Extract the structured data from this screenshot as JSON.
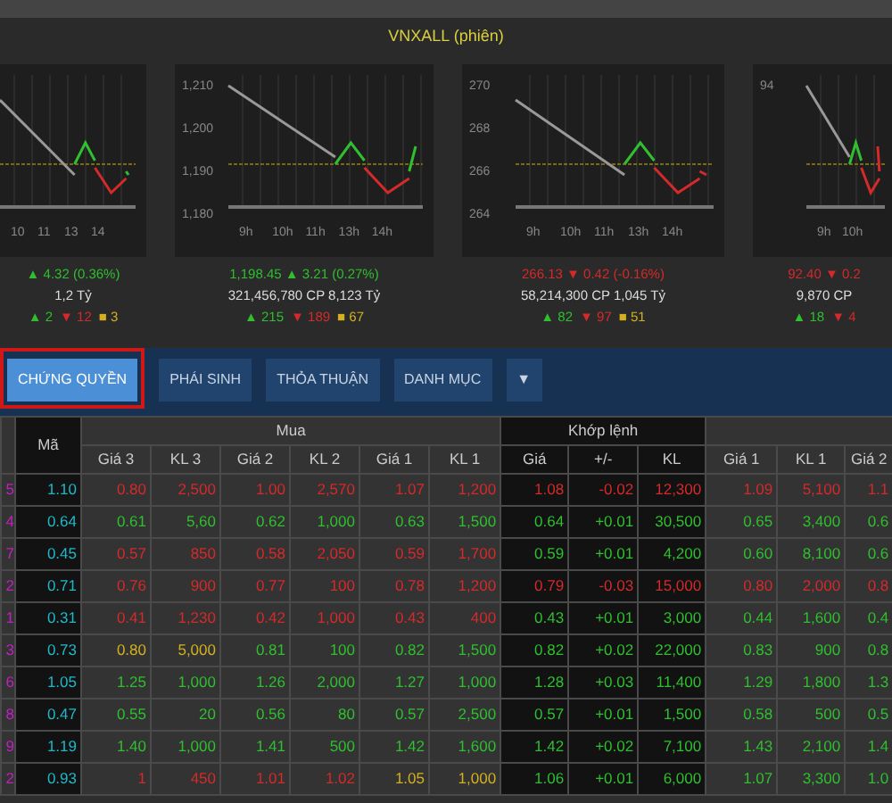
{
  "title": "VNXALL (phiên)",
  "charts": [
    {
      "color": "#2fbf2f",
      "time_labels": [
        "10",
        "11",
        "13",
        "14"
      ],
      "value": "▲ 4.32 (0.36%)",
      "volume": "1,2 Tỷ",
      "up": "▲ 2",
      "down": "▼ 12",
      "ref": "■ 3"
    },
    {
      "color": "#2fbf2f",
      "price_labels": [
        "1,210",
        "1,200",
        "1,190",
        "1,180"
      ],
      "time_labels": [
        "9h",
        "10h",
        "11h",
        "13h",
        "14h"
      ],
      "value": "1,198.45 ▲ 3.21 (0.27%)",
      "volume": "321,456,780 CP 8,123 Tỷ",
      "up": "▲ 215",
      "down": "▼ 189",
      "ref": "■ 67"
    },
    {
      "color": "#d42a2a",
      "price_labels": [
        "270",
        "268",
        "266",
        "264"
      ],
      "time_labels": [
        "9h",
        "10h",
        "11h",
        "13h",
        "14h"
      ],
      "value": "266.13 ▼ 0.42 (-0.16%)",
      "volume": "58,214,300 CP 1,045 Tỷ",
      "up": "▲ 82",
      "down": "▼ 97",
      "ref": "■ 51"
    },
    {
      "color": "#d42a2a",
      "price_labels": [
        "94"
      ],
      "time_labels": [
        "9h",
        "10h"
      ],
      "value": "92.40 ▼ 0.2",
      "volume": "9,870 CP",
      "up": "▲ 18",
      "down": "▼ 4"
    }
  ],
  "tabs": [
    {
      "label": "CHỨNG QUYỀN",
      "selected": true
    },
    {
      "label": "PHÁI SINH",
      "selected": false
    },
    {
      "label": "THỎA THUẬN",
      "selected": false
    },
    {
      "label": "DANH MỤC",
      "selected": false
    }
  ],
  "tab_menu": "▼",
  "table": {
    "groups": [
      "Mua",
      "Khớp lệnh"
    ],
    "columns": [
      "",
      "Mã",
      "Giá 3",
      "KL 3",
      "Giá 2",
      "KL 2",
      "Giá 1",
      "KL 1",
      "Giá",
      "+/-",
      "KL",
      "Giá 1",
      "KL 1",
      "Giá 2"
    ],
    "rows": [
      {
        "cells": [
          {
            "text": "5",
            "color": "#c020c0"
          },
          {
            "text": "1.10",
            "color": "#20b8c8"
          },
          {
            "text": "0.80",
            "color": "#d42a2a"
          },
          {
            "text": "2,500",
            "color": "#d42a2a"
          },
          {
            "text": "1.00",
            "color": "#d42a2a"
          },
          {
            "text": "2,570",
            "color": "#d42a2a"
          },
          {
            "text": "1.07",
            "color": "#d42a2a"
          },
          {
            "text": "1,200",
            "color": "#d42a2a"
          },
          {
            "text": "1.08",
            "color": "#d42a2a"
          },
          {
            "text": "-0.02",
            "color": "#d42a2a"
          },
          {
            "text": "12,300",
            "color": "#d42a2a"
          },
          {
            "text": "1.09",
            "color": "#d42a2a"
          },
          {
            "text": "5,100",
            "color": "#d42a2a"
          },
          {
            "text": "1.1",
            "color": "#d42a2a"
          }
        ]
      },
      {
        "cells": [
          {
            "text": "4",
            "color": "#c020c0"
          },
          {
            "text": "0.64",
            "color": "#20b8c8"
          },
          {
            "text": "0.61",
            "color": "#2fbf2f"
          },
          {
            "text": "5,60",
            "color": "#2fbf2f"
          },
          {
            "text": "0.62",
            "color": "#2fbf2f"
          },
          {
            "text": "1,000",
            "color": "#2fbf2f"
          },
          {
            "text": "0.63",
            "color": "#2fbf2f"
          },
          {
            "text": "1,500",
            "color": "#2fbf2f"
          },
          {
            "text": "0.64",
            "color": "#2fbf2f"
          },
          {
            "text": "+0.01",
            "color": "#2fbf2f"
          },
          {
            "text": "30,500",
            "color": "#2fbf2f"
          },
          {
            "text": "0.65",
            "color": "#2fbf2f"
          },
          {
            "text": "3,400",
            "color": "#2fbf2f"
          },
          {
            "text": "0.6",
            "color": "#2fbf2f"
          }
        ]
      },
      {
        "cells": [
          {
            "text": "7",
            "color": "#c020c0"
          },
          {
            "text": "0.45",
            "color": "#20b8c8"
          },
          {
            "text": "0.57",
            "color": "#d42a2a"
          },
          {
            "text": "850",
            "color": "#d42a2a"
          },
          {
            "text": "0.58",
            "color": "#d42a2a"
          },
          {
            "text": "2,050",
            "color": "#d42a2a"
          },
          {
            "text": "0.59",
            "color": "#d42a2a"
          },
          {
            "text": "1,700",
            "color": "#d42a2a"
          },
          {
            "text": "0.59",
            "color": "#2fbf2f"
          },
          {
            "text": "+0.01",
            "color": "#2fbf2f"
          },
          {
            "text": "4,200",
            "color": "#2fbf2f"
          },
          {
            "text": "0.60",
            "color": "#2fbf2f"
          },
          {
            "text": "8,100",
            "color": "#2fbf2f"
          },
          {
            "text": "0.6",
            "color": "#2fbf2f"
          }
        ]
      },
      {
        "cells": [
          {
            "text": "2",
            "color": "#c020c0"
          },
          {
            "text": "0.71",
            "color": "#20b8c8"
          },
          {
            "text": "0.76",
            "color": "#d42a2a"
          },
          {
            "text": "900",
            "color": "#d42a2a"
          },
          {
            "text": "0.77",
            "color": "#d42a2a"
          },
          {
            "text": "100",
            "color": "#d42a2a"
          },
          {
            "text": "0.78",
            "color": "#d42a2a"
          },
          {
            "text": "1,200",
            "color": "#d42a2a"
          },
          {
            "text": "0.79",
            "color": "#d42a2a"
          },
          {
            "text": "-0.03",
            "color": "#d42a2a"
          },
          {
            "text": "15,000",
            "color": "#d42a2a"
          },
          {
            "text": "0.80",
            "color": "#d42a2a"
          },
          {
            "text": "2,000",
            "color": "#d42a2a"
          },
          {
            "text": "0.8",
            "color": "#d42a2a"
          }
        ]
      },
      {
        "cells": [
          {
            "text": "1",
            "color": "#c020c0"
          },
          {
            "text": "0.31",
            "color": "#20b8c8"
          },
          {
            "text": "0.41",
            "color": "#d42a2a"
          },
          {
            "text": "1,230",
            "color": "#d42a2a"
          },
          {
            "text": "0.42",
            "color": "#d42a2a"
          },
          {
            "text": "1,000",
            "color": "#d42a2a"
          },
          {
            "text": "0.43",
            "color": "#d42a2a"
          },
          {
            "text": "400",
            "color": "#d42a2a"
          },
          {
            "text": "0.43",
            "color": "#2fbf2f"
          },
          {
            "text": "+0.01",
            "color": "#2fbf2f"
          },
          {
            "text": "3,000",
            "color": "#2fbf2f"
          },
          {
            "text": "0.44",
            "color": "#2fbf2f"
          },
          {
            "text": "1,600",
            "color": "#2fbf2f"
          },
          {
            "text": "0.4",
            "color": "#2fbf2f"
          }
        ]
      },
      {
        "cells": [
          {
            "text": "3",
            "color": "#c020c0"
          },
          {
            "text": "0.73",
            "color": "#20b8c8"
          },
          {
            "text": "0.80",
            "color": "#d4b020"
          },
          {
            "text": "5,000",
            "color": "#d4b020"
          },
          {
            "text": "0.81",
            "color": "#2fbf2f"
          },
          {
            "text": "100",
            "color": "#2fbf2f"
          },
          {
            "text": "0.82",
            "color": "#2fbf2f"
          },
          {
            "text": "1,500",
            "color": "#2fbf2f"
          },
          {
            "text": "0.82",
            "color": "#2fbf2f"
          },
          {
            "text": "+0.02",
            "color": "#2fbf2f"
          },
          {
            "text": "22,000",
            "color": "#2fbf2f"
          },
          {
            "text": "0.83",
            "color": "#2fbf2f"
          },
          {
            "text": "900",
            "color": "#2fbf2f"
          },
          {
            "text": "0.8",
            "color": "#2fbf2f"
          }
        ]
      },
      {
        "cells": [
          {
            "text": "6",
            "color": "#c020c0"
          },
          {
            "text": "1.05",
            "color": "#20b8c8"
          },
          {
            "text": "1.25",
            "color": "#2fbf2f"
          },
          {
            "text": "1,000",
            "color": "#2fbf2f"
          },
          {
            "text": "1.26",
            "color": "#2fbf2f"
          },
          {
            "text": "2,000",
            "color": "#2fbf2f"
          },
          {
            "text": "1.27",
            "color": "#2fbf2f"
          },
          {
            "text": "1,000",
            "color": "#2fbf2f"
          },
          {
            "text": "1.28",
            "color": "#2fbf2f"
          },
          {
            "text": "+0.03",
            "color": "#2fbf2f"
          },
          {
            "text": "11,400",
            "color": "#2fbf2f"
          },
          {
            "text": "1.29",
            "color": "#2fbf2f"
          },
          {
            "text": "1,800",
            "color": "#2fbf2f"
          },
          {
            "text": "1.3",
            "color": "#2fbf2f"
          }
        ]
      },
      {
        "cells": [
          {
            "text": "8",
            "color": "#c020c0"
          },
          {
            "text": "0.47",
            "color": "#20b8c8"
          },
          {
            "text": "0.55",
            "color": "#2fbf2f"
          },
          {
            "text": "20",
            "color": "#2fbf2f"
          },
          {
            "text": "0.56",
            "color": "#2fbf2f"
          },
          {
            "text": "80",
            "color": "#2fbf2f"
          },
          {
            "text": "0.57",
            "color": "#2fbf2f"
          },
          {
            "text": "2,500",
            "color": "#2fbf2f"
          },
          {
            "text": "0.57",
            "color": "#2fbf2f"
          },
          {
            "text": "+0.01",
            "color": "#2fbf2f"
          },
          {
            "text": "1,500",
            "color": "#2fbf2f"
          },
          {
            "text": "0.58",
            "color": "#2fbf2f"
          },
          {
            "text": "500",
            "color": "#2fbf2f"
          },
          {
            "text": "0.5",
            "color": "#2fbf2f"
          }
        ]
      },
      {
        "cells": [
          {
            "text": "9",
            "color": "#c020c0"
          },
          {
            "text": "1.19",
            "color": "#20b8c8"
          },
          {
            "text": "1.40",
            "color": "#2fbf2f"
          },
          {
            "text": "1,000",
            "color": "#2fbf2f"
          },
          {
            "text": "1.41",
            "color": "#2fbf2f"
          },
          {
            "text": "500",
            "color": "#2fbf2f"
          },
          {
            "text": "1.42",
            "color": "#2fbf2f"
          },
          {
            "text": "1,600",
            "color": "#2fbf2f"
          },
          {
            "text": "1.42",
            "color": "#2fbf2f"
          },
          {
            "text": "+0.02",
            "color": "#2fbf2f"
          },
          {
            "text": "7,100",
            "color": "#2fbf2f"
          },
          {
            "text": "1.43",
            "color": "#2fbf2f"
          },
          {
            "text": "2,100",
            "color": "#2fbf2f"
          },
          {
            "text": "1.4",
            "color": "#2fbf2f"
          }
        ]
      },
      {
        "cells": [
          {
            "text": "2",
            "color": "#c020c0"
          },
          {
            "text": "0.93",
            "color": "#20b8c8"
          },
          {
            "text": "1",
            "color": "#d42a2a"
          },
          {
            "text": "450",
            "color": "#d42a2a"
          },
          {
            "text": "1.01",
            "color": "#d42a2a"
          },
          {
            "text": "1.02",
            "color": "#d42a2a"
          },
          {
            "text": "1.05",
            "color": "#d4b020"
          },
          {
            "text": "1,000",
            "color": "#d4b020"
          },
          {
            "text": "1.06",
            "color": "#2fbf2f"
          },
          {
            "text": "+0.01",
            "color": "#2fbf2f"
          },
          {
            "text": "6,000",
            "color": "#2fbf2f"
          },
          {
            "text": "1.07",
            "color": "#2fbf2f"
          },
          {
            "text": "3,300",
            "color": "#2fbf2f"
          },
          {
            "text": "1.0",
            "color": "#2fbf2f"
          }
        ]
      }
    ]
  }
}
